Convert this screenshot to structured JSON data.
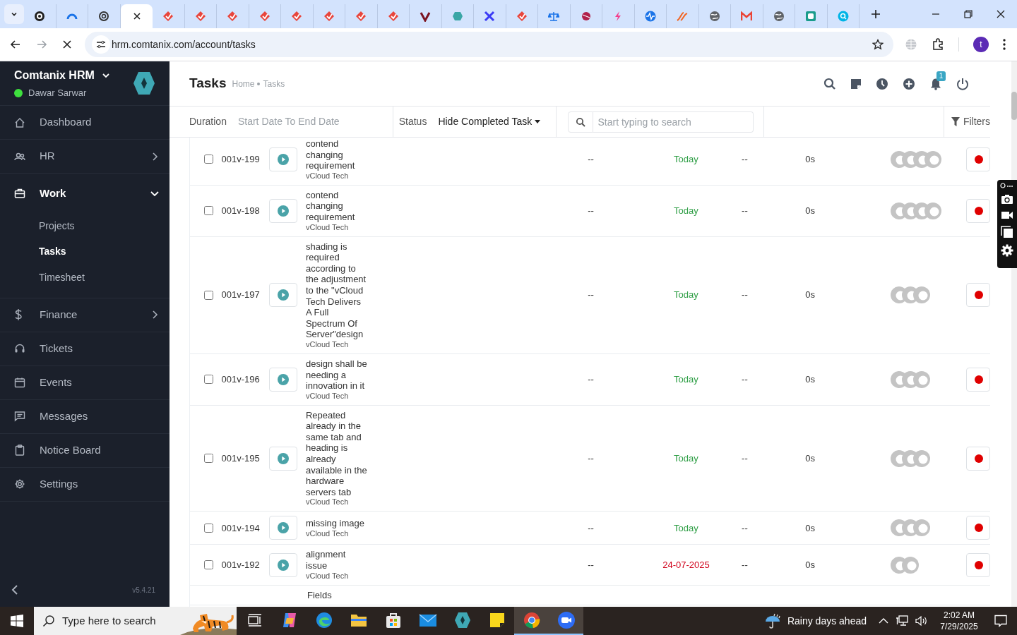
{
  "browser": {
    "tabs": [
      {
        "selected": false,
        "kind": "ring",
        "color": "#1f1f1f"
      },
      {
        "selected": false,
        "kind": "arc",
        "color": "#1a73e8"
      },
      {
        "selected": false,
        "kind": "knot",
        "color": "#333333"
      },
      {
        "selected": true
      },
      {
        "selected": false,
        "kind": "diamond",
        "color": "#e8453c"
      },
      {
        "selected": false,
        "kind": "diamond",
        "color": "#e8453c"
      },
      {
        "selected": false,
        "kind": "diamond",
        "color": "#e8453c"
      },
      {
        "selected": false,
        "kind": "diamond",
        "color": "#e8453c"
      },
      {
        "selected": false,
        "kind": "diamond",
        "color": "#e8453c"
      },
      {
        "selected": false,
        "kind": "diamond",
        "color": "#e8453c"
      },
      {
        "selected": false,
        "kind": "diamond",
        "color": "#e8453c"
      },
      {
        "selected": false,
        "kind": "diamond",
        "color": "#e8453c"
      },
      {
        "selected": false,
        "kind": "check",
        "color": "#7a1320"
      },
      {
        "selected": false,
        "kind": "hexagon",
        "color": "#3aa6a6"
      },
      {
        "selected": false,
        "kind": "cross",
        "color": "#3b3bf5"
      },
      {
        "selected": false,
        "kind": "diamond",
        "color": "#e8453c"
      },
      {
        "selected": false,
        "kind": "scales",
        "color": "#1a73e8"
      },
      {
        "selected": false,
        "kind": "ball",
        "color": "#b0204a"
      },
      {
        "selected": false,
        "kind": "bolt",
        "color": "#f43f8e"
      },
      {
        "selected": false,
        "kind": "pulse",
        "color": "#1a73e8"
      },
      {
        "selected": false,
        "kind": "swoosh",
        "color": "#f26522"
      },
      {
        "selected": false,
        "kind": "globe",
        "color": "#5f6368"
      },
      {
        "selected": false,
        "kind": "mail",
        "color": "#ea4335"
      },
      {
        "selected": false,
        "kind": "globe",
        "color": "#5f6368"
      },
      {
        "selected": false,
        "kind": "square",
        "color": "#1a9c8c"
      },
      {
        "selected": false,
        "kind": "search",
        "color": "#00b4e6"
      }
    ],
    "url": "hrm.comtanix.com/account/tasks",
    "profile_initial": "t"
  },
  "sidebar": {
    "app_name": "Comtanix HRM",
    "user": "Dawar Sarwar",
    "user_online": true,
    "items": [
      {
        "label": "Dashboard",
        "kind": "link",
        "selected": false
      },
      {
        "label": "HR",
        "kind": "group",
        "expanded": false,
        "selected": false
      },
      {
        "label": "Work",
        "kind": "group",
        "expanded": true,
        "selected": false,
        "children": [
          {
            "label": "Projects",
            "selected": false
          },
          {
            "label": "Tasks",
            "selected": true
          },
          {
            "label": "Timesheet",
            "selected": false
          }
        ]
      },
      {
        "label": "Finance",
        "kind": "group",
        "expanded": false,
        "selected": false
      },
      {
        "label": "Tickets",
        "kind": "link",
        "selected": false
      },
      {
        "label": "Events",
        "kind": "link",
        "selected": false
      },
      {
        "label": "Messages",
        "kind": "link",
        "selected": false
      },
      {
        "label": "Notice Board",
        "kind": "link",
        "selected": false
      },
      {
        "label": "Settings",
        "kind": "link",
        "selected": false
      }
    ],
    "version": "v5.4.21"
  },
  "header": {
    "title": "Tasks",
    "breadcrumb": [
      "Home",
      "Tasks"
    ],
    "notification_count": "1"
  },
  "filters": {
    "duration_label": "Duration",
    "duration_placeholder": "Start Date To End Date",
    "status_label": "Status",
    "status_value": "Hide Completed Task",
    "search_placeholder": "Start typing to search",
    "filters_button": "Filters"
  },
  "tasks": [
    {
      "checked": false,
      "id": "001v-199",
      "title": "contend changing requirement",
      "project": "vCloud Tech",
      "column_5": "--",
      "due": "Today",
      "color": "#2e9e45",
      "column_7": "--",
      "time": "0s",
      "assignees": [
        {
          "kind": "avatar"
        },
        {
          "kind": "avatar"
        },
        {
          "kind": "avatar"
        },
        {
          "kind": "avatar"
        }
      ]
    },
    {
      "checked": false,
      "id": "001v-198",
      "title": "contend changing requirement",
      "project": "vCloud Tech",
      "column_5": "--",
      "due": "Today",
      "color": "#2e9e45",
      "column_7": "--",
      "time": "0s",
      "assignees": [
        {
          "kind": "avatar"
        },
        {
          "kind": "avatar"
        },
        {
          "kind": "avatar"
        },
        {
          "kind": "avatar"
        }
      ]
    },
    {
      "checked": false,
      "id": "001v-197",
      "title": "shading is required according to the adjustment to the \"vCloud Tech Delivers A Full Spectrum Of Server\"design",
      "project": "vCloud Tech",
      "column_5": "--",
      "due": "Today",
      "color": "#2e9e45",
      "column_7": "--",
      "time": "0s",
      "assignees": [
        {
          "kind": "avatar"
        },
        {
          "kind": "avatar"
        },
        {
          "kind": "avatar"
        }
      ]
    },
    {
      "checked": false,
      "id": "001v-196",
      "title": "design shall be needing a innovation in it",
      "project": "vCloud Tech",
      "column_5": "--",
      "due": "Today",
      "color": "#2e9e45",
      "column_7": "--",
      "time": "0s",
      "assignees": [
        {
          "kind": "avatar"
        },
        {
          "kind": "avatar"
        },
        {
          "kind": "avatar"
        }
      ]
    },
    {
      "checked": false,
      "id": "001v-195",
      "title": "Repeated already in the same tab and heading is already available in the hardware servers tab",
      "project": "vCloud Tech",
      "column_5": "--",
      "due": "Today",
      "color": "#2e9e45",
      "column_7": "--",
      "time": "0s",
      "assignees": [
        {
          "kind": "avatar"
        },
        {
          "kind": "avatar"
        },
        {
          "kind": "avatar"
        }
      ]
    },
    {
      "checked": false,
      "id": "001v-194",
      "title": "missing image",
      "project": "vCloud Tech",
      "column_5": "--",
      "due": "Today",
      "color": "#2e9e45",
      "column_7": "--",
      "time": "0s",
      "assignees": [
        {
          "kind": "avatar"
        },
        {
          "kind": "avatar"
        },
        {
          "kind": "avatar"
        }
      ]
    },
    {
      "checked": false,
      "id": "001v-192",
      "title": "alignment issue",
      "project": "vCloud Tech",
      "column_5": "--",
      "due": "24-07-2025",
      "color": "#d0021b",
      "column_7": "--",
      "time": "0s",
      "assignees": [
        {
          "kind": "avatar"
        },
        {
          "kind": "avatar"
        }
      ]
    },
    {
      "title": "Fields"
    }
  ],
  "taskbar": {
    "search_placeholder": "Type here to search",
    "apps": [
      {
        "kind": "taskview",
        "active": false
      },
      {
        "kind": "copilot",
        "active": false
      },
      {
        "kind": "edge",
        "active": false
      },
      {
        "kind": "folder",
        "active": false
      },
      {
        "kind": "store",
        "active": false
      },
      {
        "kind": "mail",
        "active": false
      },
      {
        "kind": "hrm",
        "active": false
      },
      {
        "kind": "sticky",
        "active": false
      },
      {
        "kind": "chrome",
        "active": true
      },
      {
        "kind": "zoom",
        "active": true
      }
    ],
    "weather": "Rainy days ahead",
    "time": "2:02 AM",
    "date": "7/29/2025"
  }
}
